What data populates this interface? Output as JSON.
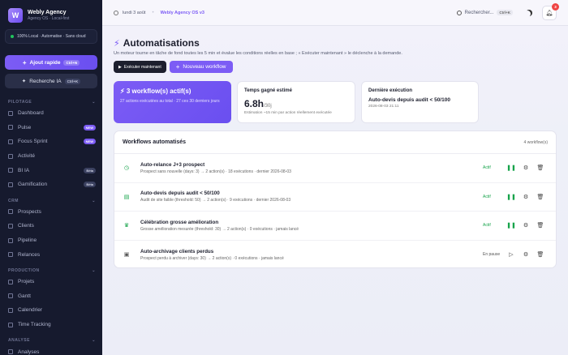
{
  "sidebar": {
    "brand_name": "Webly Agency",
    "brand_sub": "Agency OS · Local-first",
    "status": "100% Local · Automatise · Sans cloud",
    "quick_add": {
      "label": "Ajout rapide",
      "kbd": "Ctrl+N"
    },
    "search_ai": {
      "label": "Recherche IA",
      "kbd": "Ctrl+K"
    },
    "sections": [
      {
        "title": "PILOTAGE",
        "items": [
          {
            "label": "Dashboard",
            "icon": "grid-icon"
          },
          {
            "label": "Pulse",
            "icon": "pulse-icon",
            "badge": "NEW"
          },
          {
            "label": "Focus Sprint",
            "icon": "target-icon",
            "badge": "NEW"
          },
          {
            "label": "Activité",
            "icon": "activity-icon"
          },
          {
            "label": "BI IA",
            "icon": "chart-icon",
            "badge": "Bêta"
          },
          {
            "label": "Gamification",
            "icon": "trophy-icon",
            "badge": "Bêta"
          }
        ]
      },
      {
        "title": "CRM",
        "items": [
          {
            "label": "Prospects",
            "icon": "users-icon"
          },
          {
            "label": "Clients",
            "icon": "user-icon"
          },
          {
            "label": "Pipeline",
            "icon": "pipeline-icon"
          },
          {
            "label": "Relances",
            "icon": "refresh-icon"
          }
        ]
      },
      {
        "title": "PRODUCTION",
        "items": [
          {
            "label": "Projets",
            "icon": "folder-icon"
          },
          {
            "label": "Gantt",
            "icon": "gantt-icon"
          },
          {
            "label": "Calendrier",
            "icon": "calendar-icon"
          },
          {
            "label": "Time Tracking",
            "icon": "clock-icon"
          }
        ]
      },
      {
        "title": "ANALYSE",
        "items": [
          {
            "label": "Analyses",
            "icon": "analytics-icon"
          }
        ]
      }
    ]
  },
  "topbar": {
    "date": "lundi 3 août",
    "version": "Webly Agency OS v3",
    "search_label": "Rechercher...",
    "search_kbd": "Ctrl+K",
    "notif_count": "3"
  },
  "page": {
    "title": "Automatisations",
    "description": "Un moteur tourne en tâche de fond toutes les 5 min et évalue les conditions réelles en base ; « Exécuter maintenant » le déclenche à la demande.",
    "run_now": "Exécuter maintenant",
    "new_workflow": "Nouveau workflow"
  },
  "cards": {
    "active": {
      "title": "3 workflow(s) actif(s)",
      "sub": "27 actions exécutées au total · 27 ces 30 derniers jours"
    },
    "time": {
      "title": "Temps gagné estimé",
      "value": "6.8h",
      "unit": "/30j",
      "sub": "Estimation ~15 min par action réellement exécutée"
    },
    "last": {
      "title": "Dernière exécution",
      "name": "Auto-devis depuis audit < 50/100",
      "date": "2026-08-03 21:11"
    }
  },
  "workflows": {
    "title": "Workflows automatisés",
    "count": "4 workflow(s)",
    "items": [
      {
        "name": "Auto-relance J+3 prospect",
        "detail": "Prospect sans nouvelle (days: 3) → 2 action(s) · 18 exécutions · dernier 2026-08-03",
        "status": "Actif",
        "icon": "clock-icon",
        "color": "#16a34a",
        "glyph": "◷"
      },
      {
        "name": "Auto-devis depuis audit < 50/100",
        "detail": "Audit de site faible (threshold: 50) → 2 action(s) · 9 exécutions · dernier 2026-08-03",
        "status": "Actif",
        "icon": "document-icon",
        "color": "#16a34a",
        "glyph": "▤"
      },
      {
        "name": "Célébration grosse amélioration",
        "detail": "Grosse amélioration mesurée (threshold: 30) → 2 action(s) · 0 exécutions · jamais lancé",
        "status": "Actif",
        "icon": "trophy-icon",
        "color": "#16a34a",
        "glyph": "♛"
      },
      {
        "name": "Auto-archivage clients perdus",
        "detail": "Prospect perdu à archiver (days: 30) → 2 action(s) · 0 exécutions · jamais lancé",
        "status": "En pause",
        "icon": "archive-icon",
        "color": "#555555",
        "glyph": "▣"
      }
    ]
  }
}
